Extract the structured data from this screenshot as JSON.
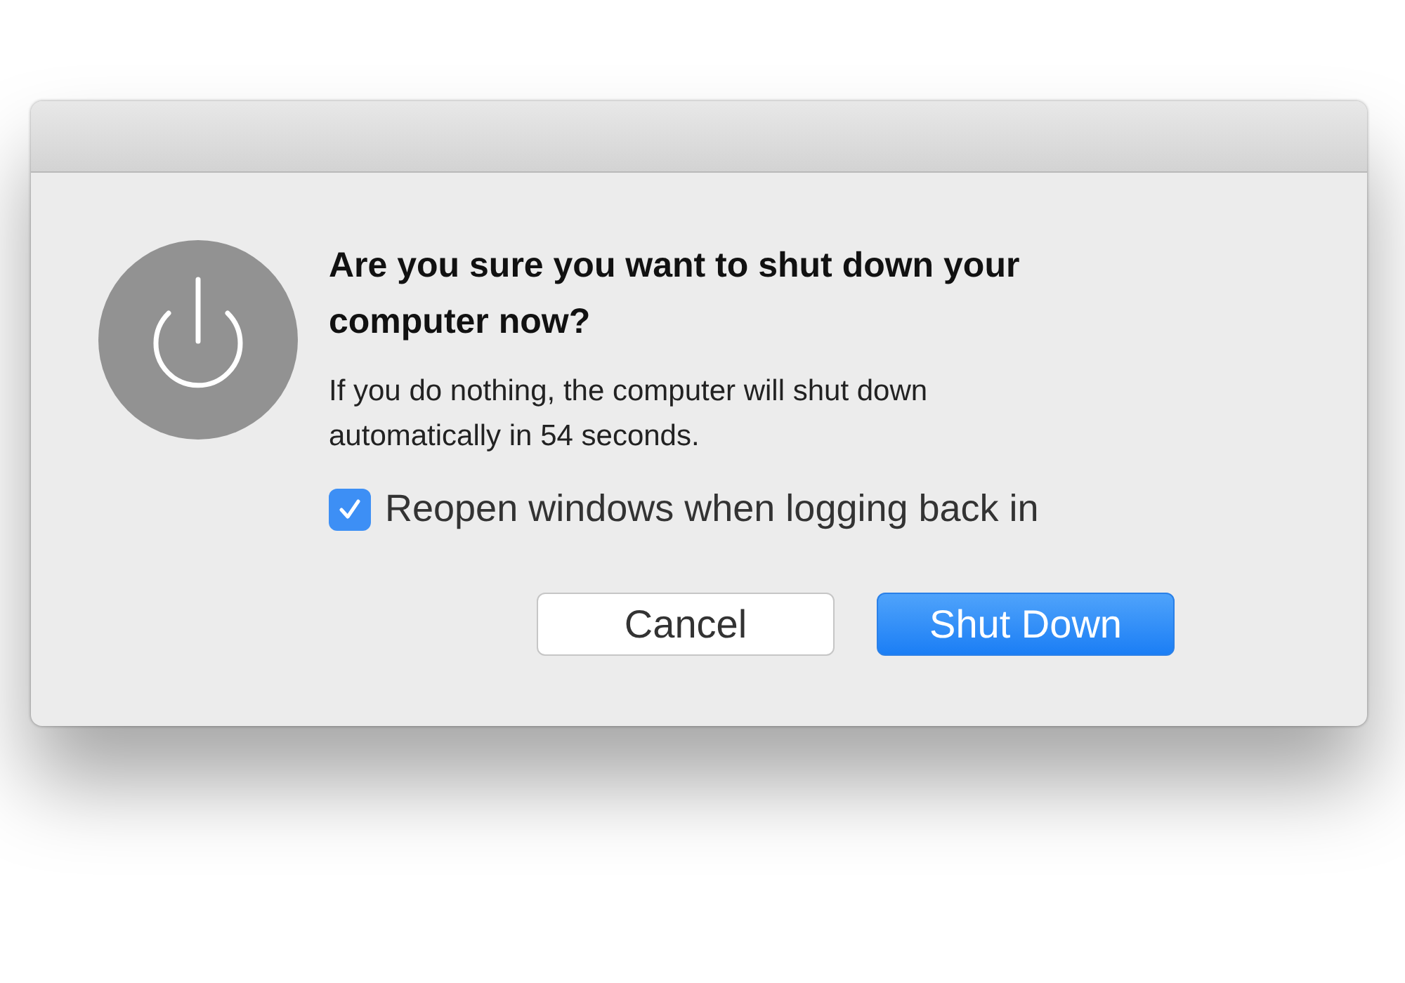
{
  "dialog": {
    "title": "Are you sure you want to shut down your computer now?",
    "message": "If you do nothing, the computer will shut down automatically in 54 seconds.",
    "checkbox": {
      "label": "Reopen windows when logging back in",
      "checked": true
    },
    "buttons": [
      {
        "label": "Cancel",
        "kind": "secondary"
      },
      {
        "label": "Shut Down",
        "kind": "primary"
      }
    ]
  }
}
